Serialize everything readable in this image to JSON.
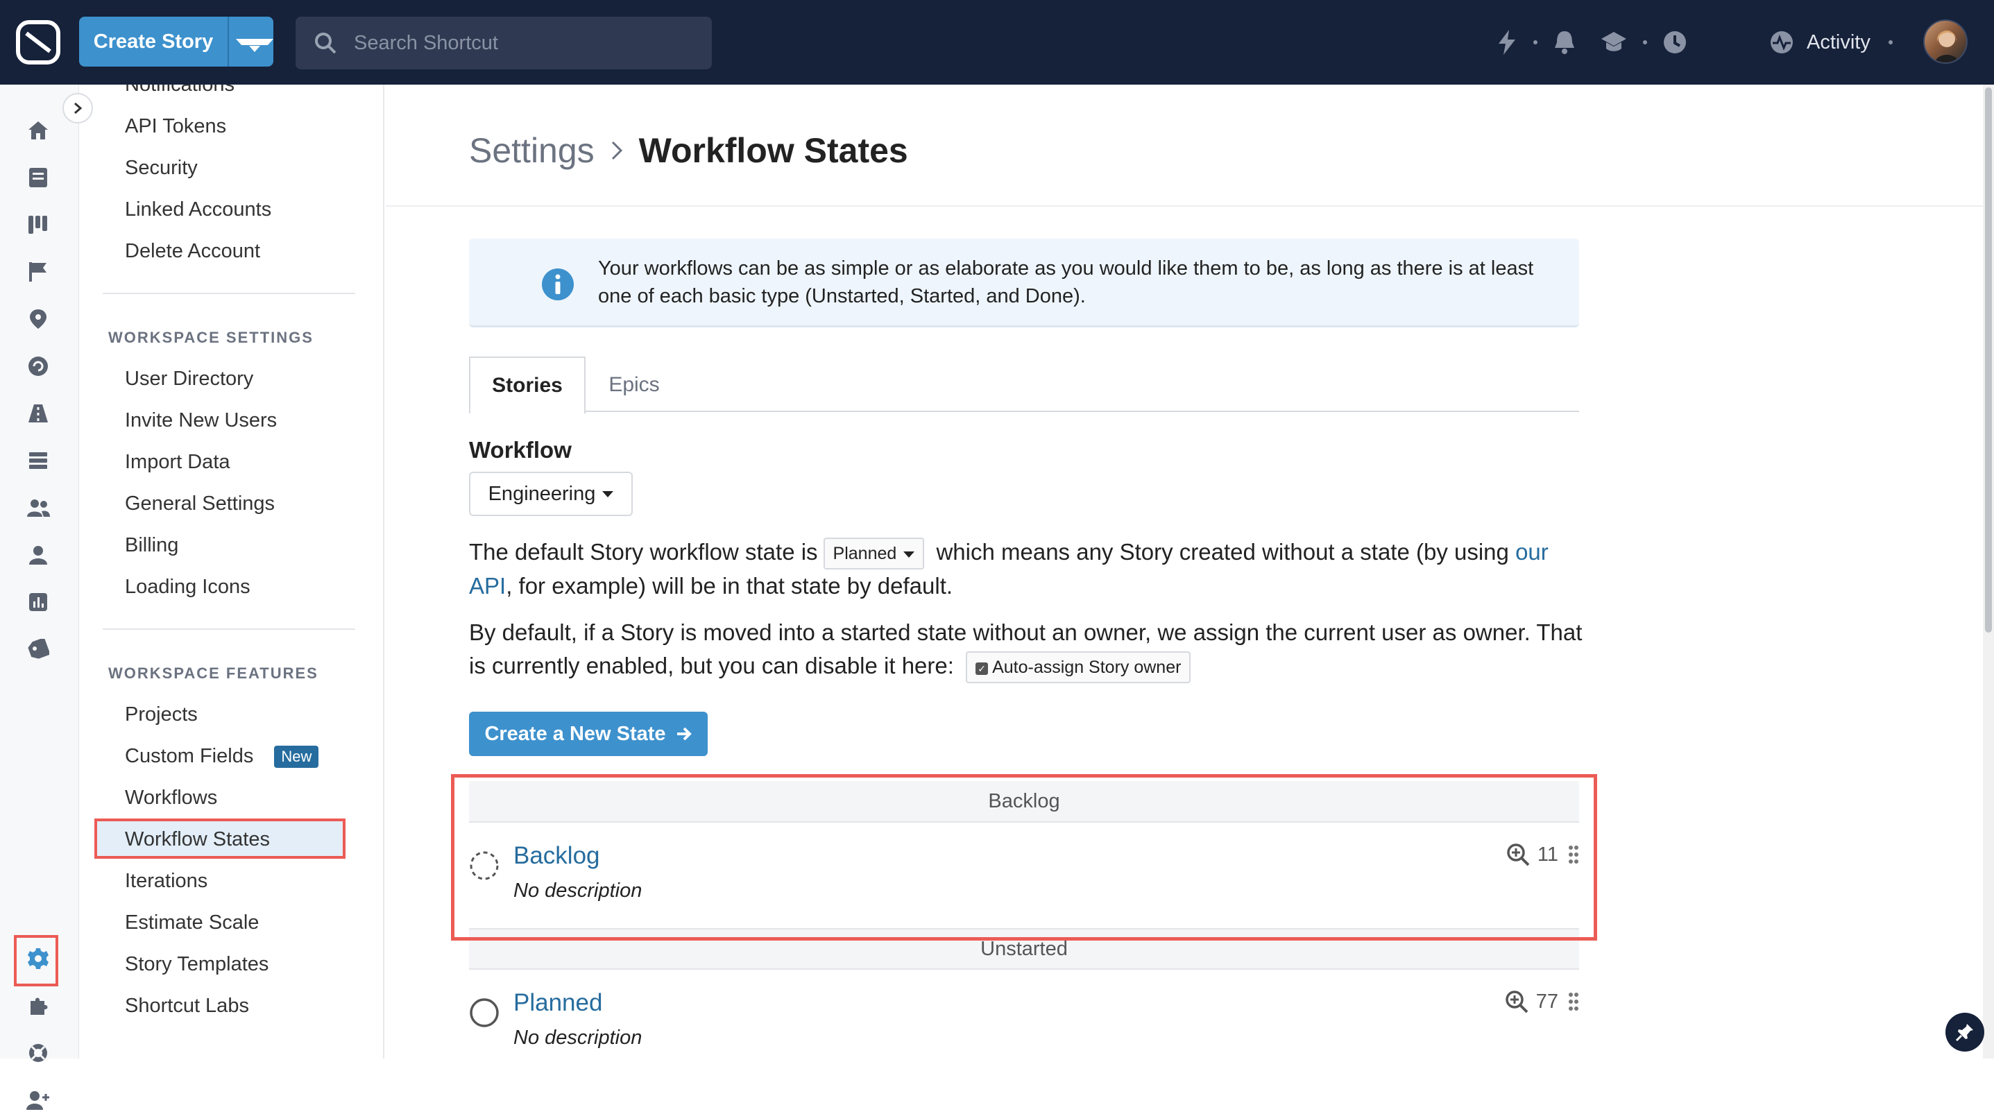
{
  "topbar": {
    "create_label": "Create Story",
    "search_placeholder": "Search Shortcut",
    "activity_label": "Activity"
  },
  "sidebar": {
    "account_items": [
      "Notifications",
      "API Tokens",
      "Security",
      "Linked Accounts",
      "Delete Account"
    ],
    "workspace_settings_heading": "WORKSPACE SETTINGS",
    "workspace_settings_items": [
      "User Directory",
      "Invite New Users",
      "Import Data",
      "General Settings",
      "Billing",
      "Loading Icons"
    ],
    "workspace_features_heading": "WORKSPACE FEATURES",
    "workspace_features_items": [
      "Projects",
      "Custom Fields",
      "Workflows",
      "Workflow States",
      "Iterations",
      "Estimate Scale",
      "Story Templates",
      "Shortcut Labs"
    ],
    "new_badge": "New",
    "active_item": "Workflow States"
  },
  "page": {
    "breadcrumb_parent": "Settings",
    "title": "Workflow States",
    "info_text": "Your workflows can be as simple or as elaborate as you would like them to be, as long as there is at least one of each basic type (Unstarted, Started, and Done).",
    "tabs": [
      "Stories",
      "Epics"
    ],
    "workflow_label": "Workflow",
    "workflow_value": "Engineering",
    "default_text_1": "The default Story workflow state is",
    "default_state": "Planned",
    "default_text_2": "which means any Story created without a state (by using",
    "api_link": "our API",
    "default_text_3": ", for example) will be in that state by default.",
    "owner_text": "By default, if a Story is moved into a started state without an owner, we assign the current user as owner. That is currently enabled, but you can disable it here:",
    "auto_assign_label": "Auto-assign Story owner",
    "create_state_label": "Create a New State"
  },
  "groups": [
    {
      "heading": "Backlog",
      "state": {
        "name": "Backlog",
        "description": "No description",
        "count": "11"
      }
    },
    {
      "heading": "Unstarted",
      "state": {
        "name": "Planned",
        "description": "No description",
        "count": "77"
      }
    }
  ],
  "colors": {
    "topbar": "#16213a",
    "accent": "#3d91cd",
    "link": "#266c9e",
    "highlight": "#ec5b55"
  }
}
